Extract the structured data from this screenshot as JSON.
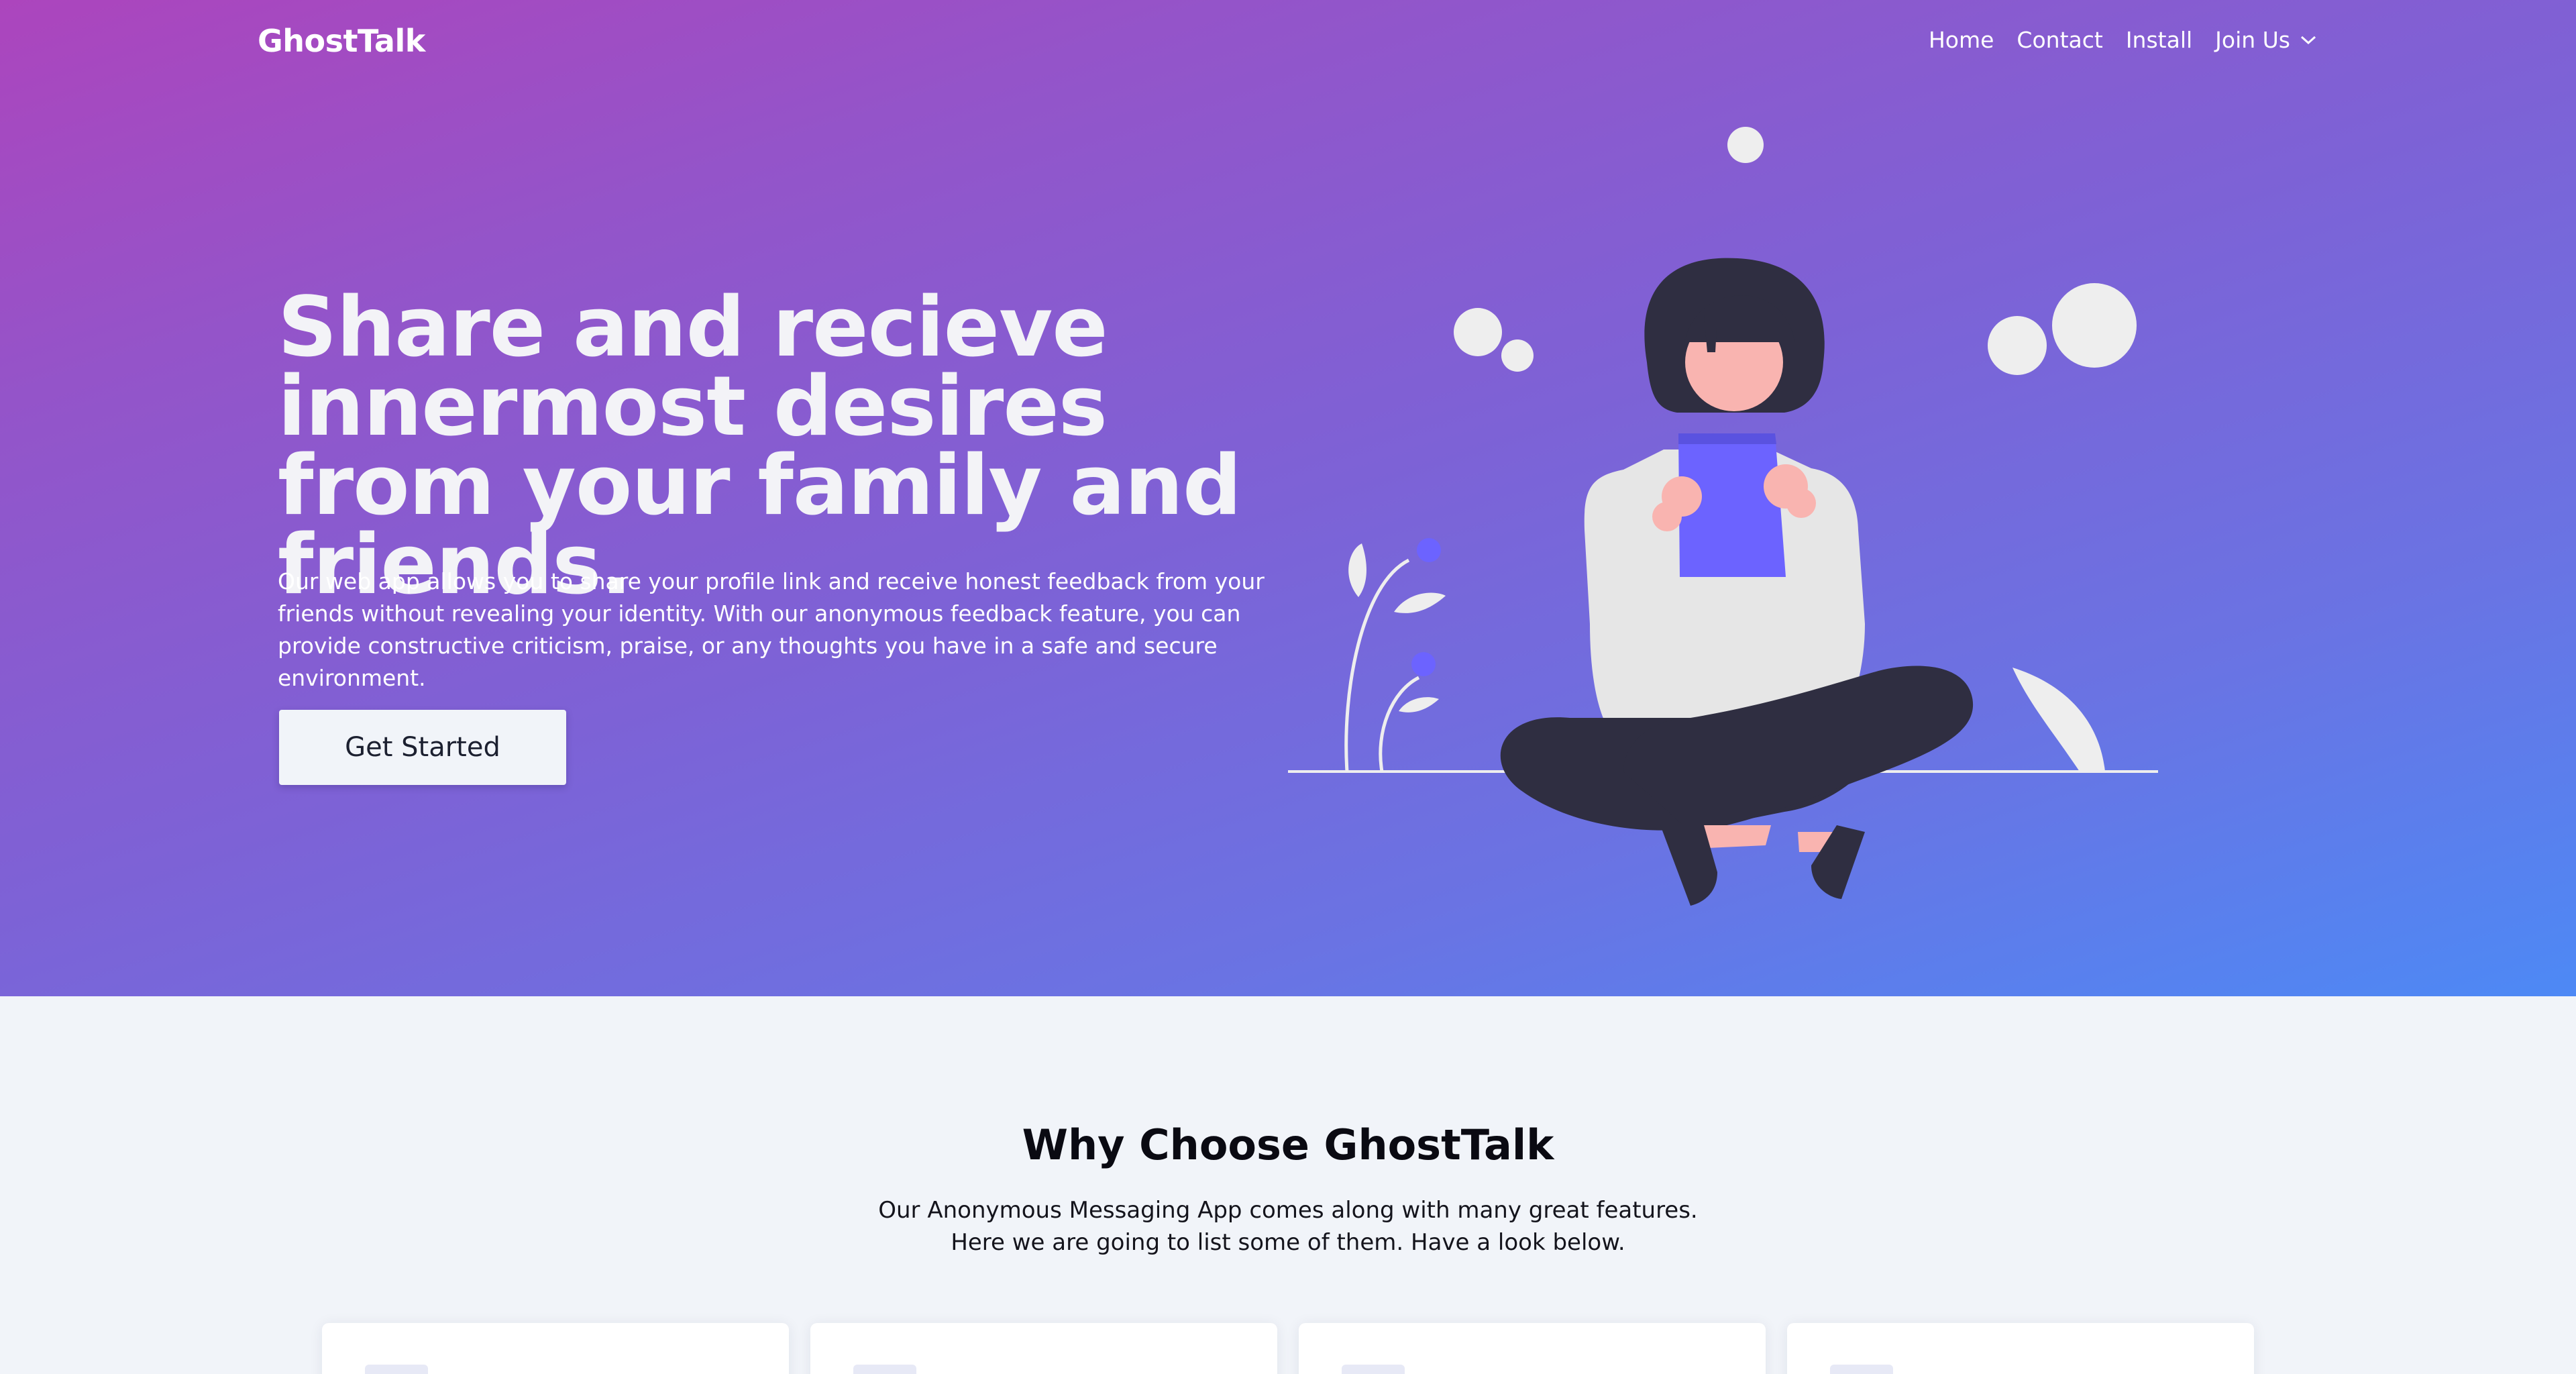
{
  "nav": {
    "brand": "GhostTalk",
    "links": [
      "Home",
      "Contact",
      "Install"
    ],
    "dropdown_label": "Join Us",
    "dropdown_icon": "chevron-down-icon"
  },
  "hero": {
    "headline": "Share and recieve innermost desires from your family and friends.",
    "description": "Our web app allows you to share your profile link and receive honest feedback from your friends without revealing your identity. With our anonymous feedback feature, you can provide constructive criticism, praise, or any thoughts you have in a safe and secure environment.",
    "cta_label": "Get Started",
    "illustration": "person-reading-illustration"
  },
  "features": {
    "title": "Why Choose GhostTalk",
    "subtitle_line1": "Our Anonymous Messaging App comes along with many great features.",
    "subtitle_line2": "Here we are going to list some of them. Have a look below.",
    "cards": [
      {
        "icon": "feature-icon"
      },
      {
        "icon": "feature-icon"
      },
      {
        "icon": "feature-icon"
      },
      {
        "icon": "feature-icon"
      }
    ]
  },
  "colors": {
    "gradient_start": "#ac45bd",
    "gradient_end": "#4d89f5",
    "accent_purple": "#6c63ff",
    "section_bg": "#f1f4f9"
  }
}
